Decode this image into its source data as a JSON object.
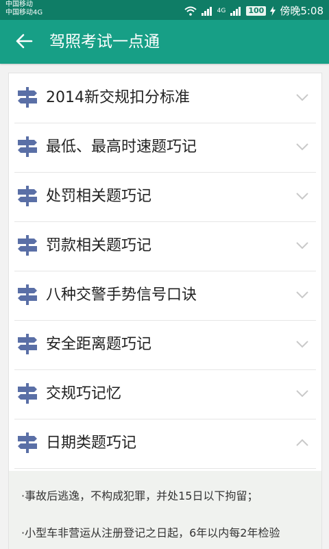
{
  "status_bar": {
    "carrier1": "中国移动",
    "carrier2": "中国移动4G",
    "network_4g": "4G",
    "battery": "100",
    "time": "傍晚5:08"
  },
  "app_bar": {
    "title": "驾照考试一点通"
  },
  "items": [
    {
      "label": "2014新交规扣分标准",
      "state": "collapsed"
    },
    {
      "label": "最低、最高时速题巧记",
      "state": "collapsed"
    },
    {
      "label": "处罚相关题巧记",
      "state": "collapsed"
    },
    {
      "label": "罚款相关题巧记",
      "state": "collapsed"
    },
    {
      "label": "八种交警手势信号口诀",
      "state": "collapsed"
    },
    {
      "label": "安全距离题巧记",
      "state": "collapsed"
    },
    {
      "label": "交规巧记忆",
      "state": "collapsed"
    },
    {
      "label": "日期类题巧记",
      "state": "expanded"
    }
  ],
  "expanded_content": {
    "lines": [
      "·事故后逃逸，不构成犯罪，并处15日以下拘留；",
      "·小型车非营运从注册登记之日起，6年以内每2年检验"
    ]
  },
  "colors": {
    "status_bar": "#0f7d66",
    "app_bar": "#179f86",
    "icon_blue": "#5a6fa6",
    "chevron": "#c9c9c9"
  }
}
